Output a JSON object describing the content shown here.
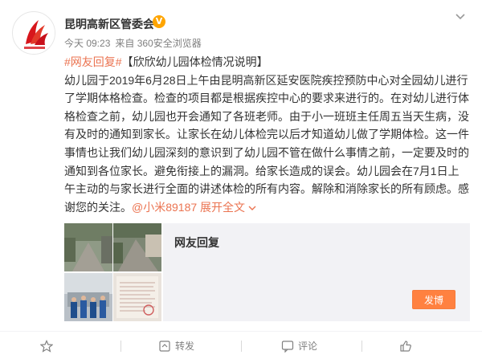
{
  "post": {
    "author": "昆明高新区管委会",
    "verified_badge": "V",
    "time": "今天 09:23",
    "source": "来自 360安全浏览器",
    "topic_tag": "#网友回复#",
    "headline": "【欣欣幼儿园体检情况说明】",
    "body": "幼儿园于2019年6月28日上午由昆明高新区延安医院疾控预防中心对全园幼儿进行了学期体格检查。检查的项目都是根据疾控中心的要求来进行的。在对幼儿进行体格检查之前，幼儿园也开会通知了各班老师。由于小一班班主任周五当天生病，没有及时的通知到家长。让家长在幼儿体检完以后才知道幼儿做了学期体检。这一件事情也让我们幼儿园深刻的意识到了幼儿园不管在做什么事情之前，一定要及时的通知到各位家长。避免衔接上的漏洞。给家长造成的误会。幼儿园会在7月1日上午主动的与家长进行全面的讲述体检的所有内容。解除和消除家长的所有顾虑。感谢您的关注。",
    "mention": "@小米89187",
    "expand_label": "展开全文",
    "panel_title": "网友回复",
    "post_button": "发博"
  },
  "actions": {
    "favorite": "",
    "repost": "转发",
    "comment": "评论",
    "like": ""
  },
  "icons": {
    "header_menu": "chevron-down-icon",
    "favorite": "star-icon",
    "repost": "repost-icon",
    "comment": "comment-icon",
    "like": "thumbs-up-icon",
    "expand": "chevron-down-icon"
  },
  "colors": {
    "accent": "#eb7350",
    "button": "#ff8140",
    "verified": "#ffa500",
    "muted": "#808080",
    "logo_red": "#d7161c"
  }
}
